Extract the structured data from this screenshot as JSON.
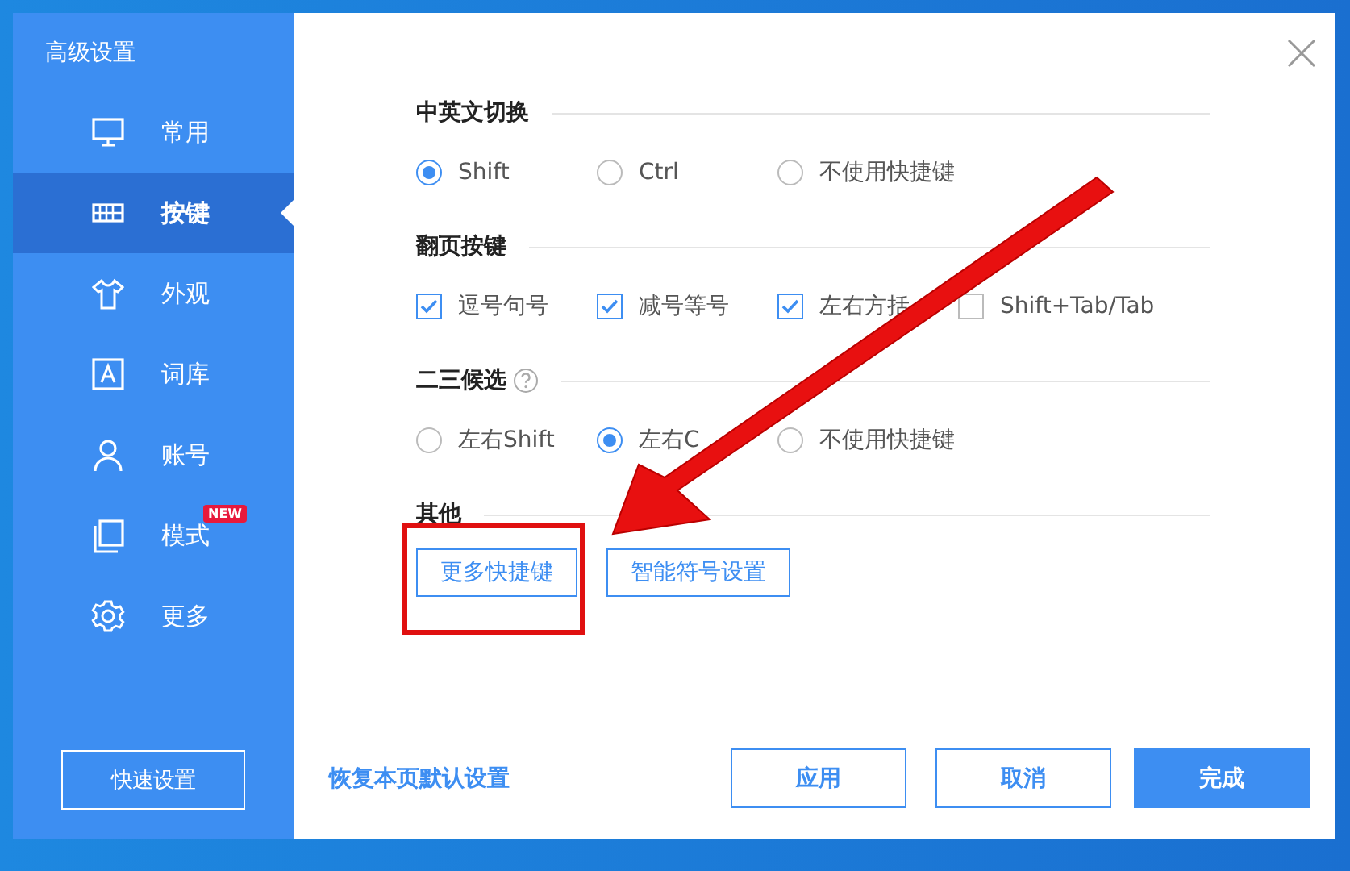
{
  "sidebar": {
    "title": "高级设置",
    "items": [
      {
        "label": "常用",
        "selected": false
      },
      {
        "label": "按键",
        "selected": true
      },
      {
        "label": "外观",
        "selected": false
      },
      {
        "label": "词库",
        "selected": false
      },
      {
        "label": "账号",
        "selected": false
      },
      {
        "label": "模式",
        "selected": false,
        "badge": "NEW"
      },
      {
        "label": "更多",
        "selected": false
      }
    ],
    "quick_button": "快速设置"
  },
  "sections": [
    {
      "title": "中英文切换",
      "kind": "radio",
      "options": [
        {
          "label": "Shift",
          "selected": true
        },
        {
          "label": "Ctrl",
          "selected": false
        },
        {
          "label": "不使用快捷键",
          "selected": false
        }
      ]
    },
    {
      "title": "翻页按键",
      "kind": "checkbox",
      "options": [
        {
          "label": "逗号句号",
          "checked": true
        },
        {
          "label": "减号等号",
          "checked": true
        },
        {
          "label": "左右方括",
          "checked": true
        },
        {
          "label": "Shift+Tab/Tab",
          "checked": false
        }
      ]
    },
    {
      "title": "二三候选",
      "help": true,
      "kind": "radio",
      "options": [
        {
          "label": "左右Shift",
          "selected": false
        },
        {
          "label": "左右C",
          "selected": true
        },
        {
          "label": "不使用快捷键",
          "selected": false
        }
      ]
    },
    {
      "title": "其他",
      "kind": "buttons",
      "buttons": [
        "更多快捷键",
        "智能符号设置"
      ]
    }
  ],
  "footer": {
    "reset_link": "恢复本页默认设置",
    "buttons": [
      {
        "label": "应用",
        "primary": false
      },
      {
        "label": "取消",
        "primary": false
      },
      {
        "label": "完成",
        "primary": true
      }
    ]
  }
}
